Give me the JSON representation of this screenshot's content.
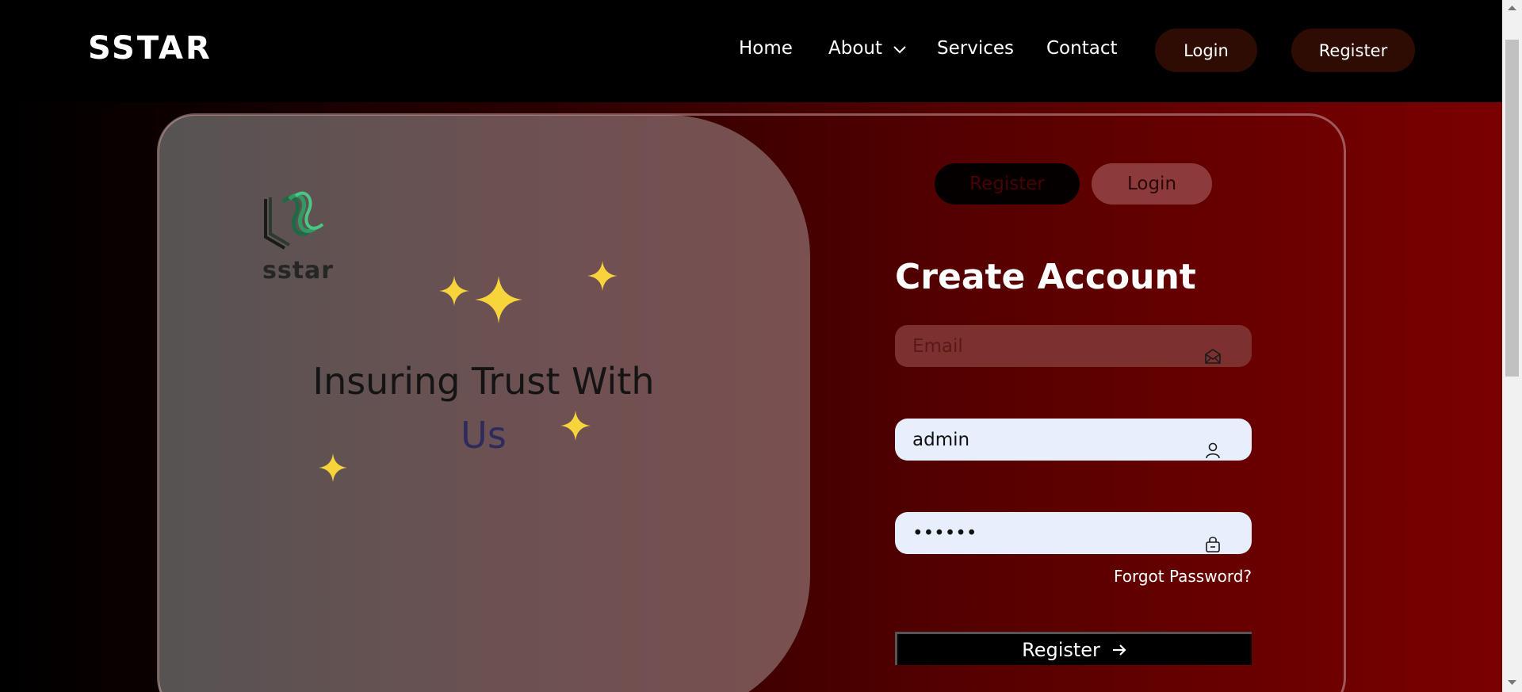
{
  "navbar": {
    "brand": "SSTAR",
    "links": [
      "Home",
      "About",
      "Services",
      "Contact"
    ],
    "login_label": "Login",
    "register_label": "Register"
  },
  "hero": {
    "logo_text": "sstar",
    "tagline_main": "Insuring Trust With",
    "tagline_accent": "Us"
  },
  "form": {
    "tab_register": "Register",
    "tab_login": "Login",
    "title": "Create Account",
    "email_placeholder": "Email",
    "username_value": "admin",
    "password_value": "••••••",
    "forgot_label": "Forgot Password?",
    "submit_label": "Register"
  },
  "colors": {
    "nav_button_bg": "#2e0c04",
    "field_bg": "#e8effc",
    "sparkle": "#f7d33c"
  },
  "icons": [
    "chevron-down-icon",
    "mail-icon",
    "user-icon",
    "lock-icon",
    "arrow-right-icon",
    "sparkle-icon"
  ]
}
